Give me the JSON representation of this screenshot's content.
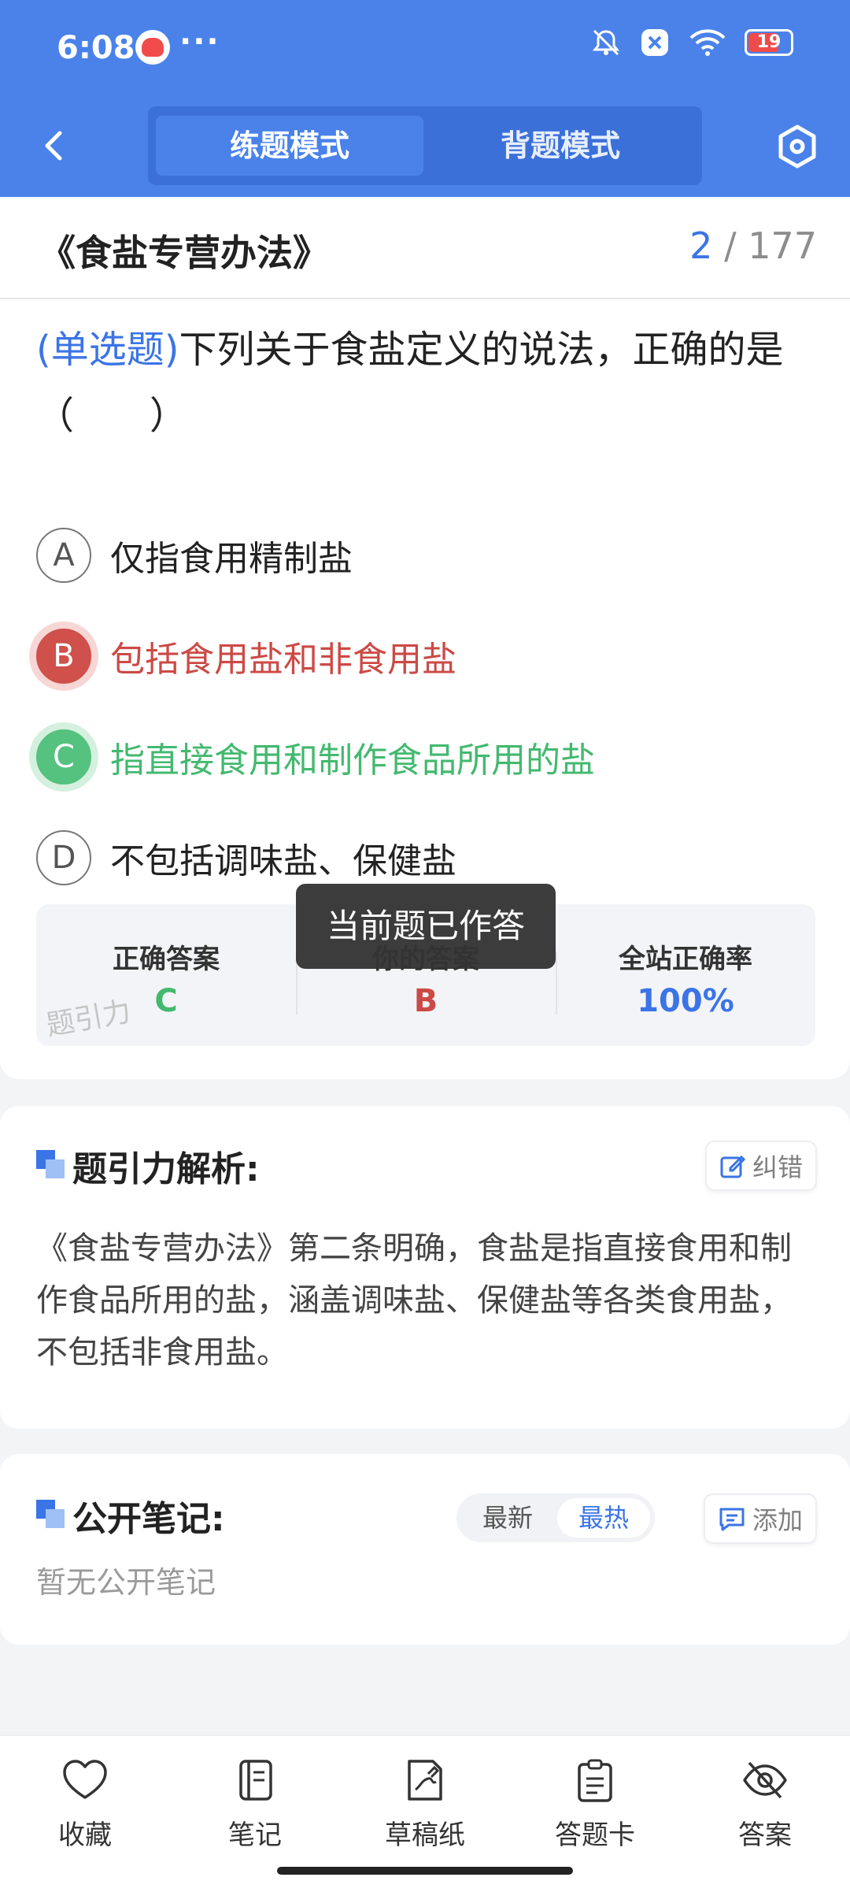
{
  "status_bar": {
    "time": "6:08",
    "dots": "···",
    "battery": "19"
  },
  "header": {
    "modes": [
      "练题模式",
      "背题模式"
    ]
  },
  "main": {
    "doc_title": "《食盐专营办法》",
    "progress_current": "2",
    "progress_total": "/ 177",
    "question_type": "(单选题)",
    "question_text": "下列关于食盐定义的说法，正确的是（　　）",
    "options": [
      {
        "letter": "A",
        "text": "仅指食用精制盐"
      },
      {
        "letter": "B",
        "text": "包括食用盐和非食用盐"
      },
      {
        "letter": "C",
        "text": "指直接食用和制作食品所用的盐"
      },
      {
        "letter": "D",
        "text": "不包括调味盐、保健盐"
      }
    ],
    "stats": {
      "correct_label": "正确答案",
      "correct_value": "C",
      "yours_label": "你的答案",
      "yours_value": "B",
      "rate_label": "全站正确率",
      "rate_value": "100%",
      "watermark": "题引力"
    },
    "toast": "当前题已作答"
  },
  "analysis": {
    "title": "题引力解析:",
    "report_label": "纠错",
    "text": "《食盐专营办法》第二条明确，食盐是指直接食用和制作食品所用的盐，涵盖调味盐、保健盐等各类食用盐，不包括非食用盐。"
  },
  "notes": {
    "title": "公开笔记:",
    "sort_tabs": [
      "最新",
      "最热"
    ],
    "add_label": "添加",
    "empty": "暂无公开笔记"
  },
  "bottom_nav": [
    {
      "label": "收藏",
      "icon": "heart-icon"
    },
    {
      "label": "笔记",
      "icon": "notebook-icon"
    },
    {
      "label": "草稿纸",
      "icon": "draft-icon"
    },
    {
      "label": "答题卡",
      "icon": "clipboard-icon"
    },
    {
      "label": "答案",
      "icon": "eye-off-icon"
    }
  ]
}
